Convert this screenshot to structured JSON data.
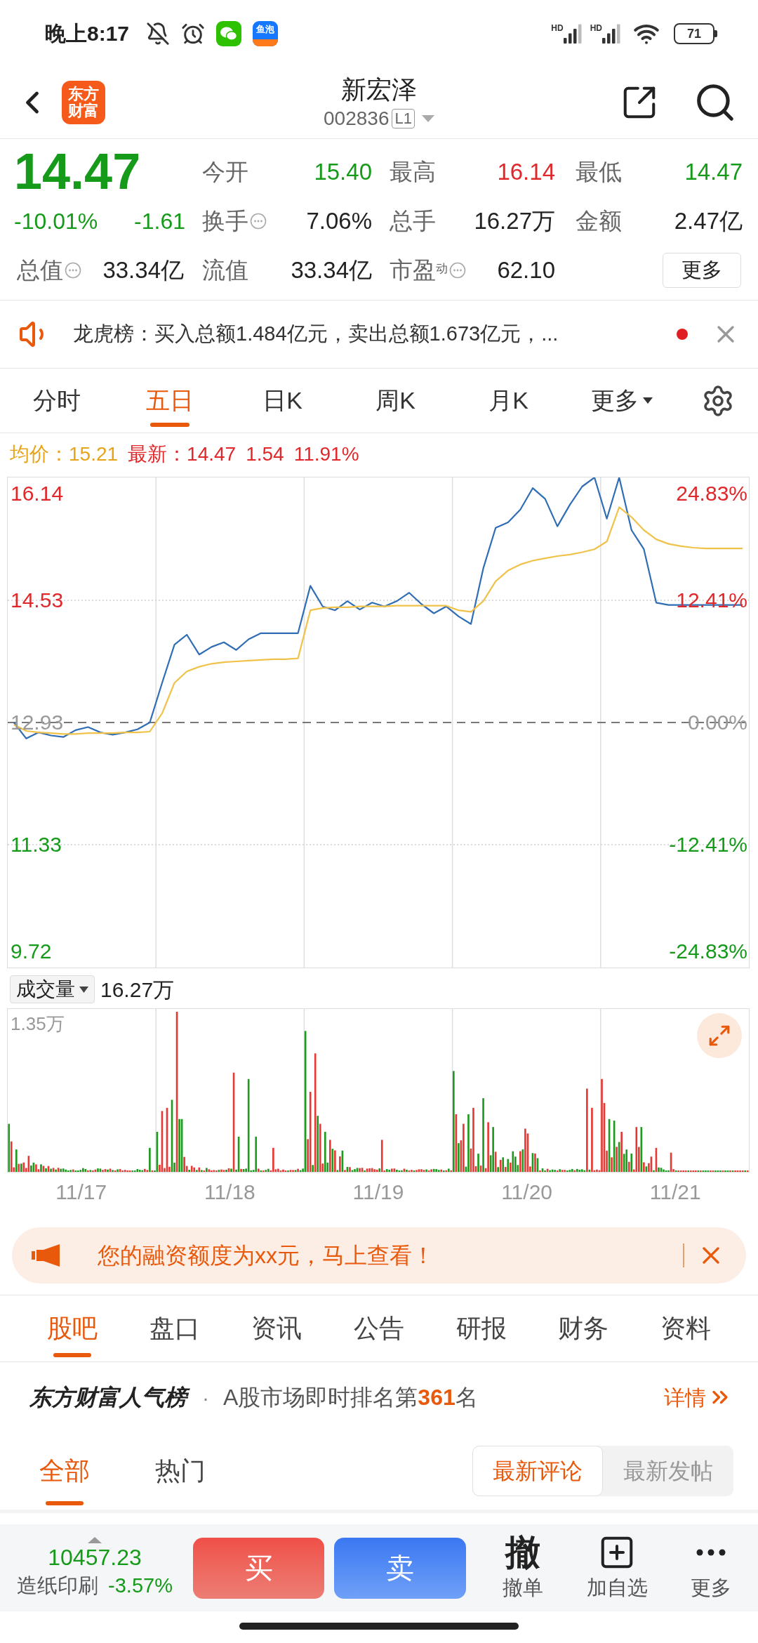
{
  "status_bar": {
    "time": "晚上8:17",
    "notification_icons": [
      {
        "kind": "mute"
      },
      {
        "kind": "alarm"
      },
      {
        "kind": "wechat"
      },
      {
        "kind": "app",
        "label": "鱼泡"
      }
    ],
    "signals": [
      {
        "label": "HD"
      },
      {
        "label": "HD"
      }
    ],
    "battery": "71"
  },
  "header": {
    "logo": "东方财富",
    "title": "新宏泽",
    "code": "002836",
    "level_badge": "L1"
  },
  "quote": {
    "price": "14.47",
    "change_pct": "-10.01%",
    "change": "-1.61",
    "color": "#169a1a",
    "stats": [
      {
        "label": "今开",
        "value": "15.40",
        "color": "#169a1a",
        "info": false
      },
      {
        "label": "最高",
        "value": "16.14",
        "color": "#e0282b",
        "info": false
      },
      {
        "label": "最低",
        "value": "14.47",
        "color": "#169a1a",
        "info": false
      },
      {
        "label": "换手",
        "value": "7.06%",
        "color": "#222222",
        "info": true
      },
      {
        "label": "总手",
        "value": "16.27万",
        "color": "#222222",
        "info": false
      },
      {
        "label": "金额",
        "value": "2.47亿",
        "color": "#222222",
        "info": false
      },
      {
        "label": "总值",
        "value": "33.34亿",
        "color": "#222222",
        "info": true
      },
      {
        "label": "流值",
        "value": "33.34亿",
        "color": "#222222",
        "info": false
      },
      {
        "label": "市盈$^{动}$",
        "value": "62.10",
        "color": "#222222",
        "info": true
      }
    ],
    "more_button": "更多"
  },
  "notice": {
    "text": "龙虎榜：买入总额1.484亿元，卖出总额1.673亿元，...",
    "unread": true
  },
  "chart_tabs": [
    {
      "label": "分时",
      "selected": false,
      "kind": "tab"
    },
    {
      "label": "五日",
      "selected": true,
      "kind": "tab"
    },
    {
      "label": "日K",
      "selected": false,
      "kind": "tab"
    },
    {
      "label": "周K",
      "selected": false,
      "kind": "tab"
    },
    {
      "label": "月K",
      "selected": false,
      "kind": "tab"
    },
    {
      "label": "更多",
      "selected": false,
      "kind": "menu"
    }
  ],
  "legend": [
    {
      "text": "均价：15.21",
      "kind": "avg"
    },
    {
      "text": "最新：14.47",
      "kind": "latest"
    },
    {
      "text": "1.54",
      "kind": "latest"
    },
    {
      "text": "11.91%",
      "kind": "latest"
    }
  ],
  "price_chart": {
    "axis_labels": [
      {
        "price": "16.14",
        "percent": "24.83%",
        "color": "#e0282b"
      },
      {
        "price": "14.53",
        "percent": "12.41%",
        "color": "#e0282b"
      },
      {
        "price": "12.93",
        "percent": "0.00%",
        "color": "#999999"
      },
      {
        "price": "11.33",
        "percent": "-12.41%",
        "color": "#169a1a"
      },
      {
        "price": "9.72",
        "percent": "-24.83%",
        "color": "#169a1a"
      }
    ],
    "chart_data": {
      "type": "line",
      "ylim": [
        9.72,
        16.14
      ],
      "yticks": [
        16.14,
        14.53,
        12.93,
        11.33,
        9.72
      ],
      "grid": true,
      "ref_lines": [
        {
          "axis": "y",
          "value": 12.93
        }
      ],
      "series": [
        {
          "color": "#2f6db5",
          "values": [
            12.93,
            12.72,
            12.8,
            12.76,
            12.74,
            12.83,
            12.87,
            12.8,
            12.77,
            12.8,
            12.84,
            12.93,
            13.45,
            13.95,
            14.08,
            13.82,
            13.92,
            13.98,
            13.88,
            14.02,
            14.1,
            14.1,
            14.1,
            14.1,
            14.72,
            14.45,
            14.4,
            14.52,
            14.41,
            14.5,
            14.45,
            14.52,
            14.63,
            14.48,
            14.36,
            14.45,
            14.32,
            14.22,
            14.95,
            15.48,
            15.55,
            15.72,
            16.0,
            15.86,
            15.5,
            15.78,
            16.02,
            16.14,
            15.6,
            16.14,
            15.45,
            15.2,
            14.5,
            14.47,
            14.47,
            14.47,
            14.47,
            14.47,
            14.47,
            14.47
          ]
        },
        {
          "color": "#f0c24a",
          "values": [
            12.9,
            12.82,
            12.8,
            12.79,
            12.78,
            12.78,
            12.79,
            12.79,
            12.79,
            12.8,
            12.8,
            12.81,
            13.05,
            13.45,
            13.6,
            13.66,
            13.7,
            13.72,
            13.73,
            13.74,
            13.75,
            13.76,
            13.76,
            13.77,
            14.4,
            14.43,
            14.44,
            14.44,
            14.45,
            14.45,
            14.45,
            14.46,
            14.46,
            14.46,
            14.46,
            14.46,
            14.4,
            14.38,
            14.52,
            14.78,
            14.92,
            15.0,
            15.05,
            15.08,
            15.11,
            15.13,
            15.16,
            15.2,
            15.3,
            15.75,
            15.62,
            15.45,
            15.33,
            15.27,
            15.24,
            15.22,
            15.21,
            15.21,
            15.21,
            15.21
          ]
        }
      ]
    }
  },
  "volume": {
    "selector": "成交量",
    "total": "16.27万",
    "max_label": "1.35万",
    "dates": [
      "11/17",
      "11/18",
      "11/19",
      "11/20",
      "11/21"
    ]
  },
  "promo": {
    "text": "您的融资额度为xx元，马上查看！"
  },
  "f10_tabs": [
    {
      "label": "股吧",
      "selected": true
    },
    {
      "label": "盘口",
      "selected": false
    },
    {
      "label": "资讯",
      "selected": false
    },
    {
      "label": "公告",
      "selected": false
    },
    {
      "label": "研报",
      "selected": false
    },
    {
      "label": "财务",
      "selected": false
    },
    {
      "label": "资料",
      "selected": false
    }
  ],
  "popularity": {
    "brand": "东方财富人气榜",
    "separator": "·",
    "text": "A股市场即时排名第**361**名",
    "link": "详情"
  },
  "feed_tabs": [
    {
      "label": "全部",
      "selected": true
    },
    {
      "label": "热门",
      "selected": false
    }
  ],
  "sort_options": [
    {
      "label": "最新评论",
      "selected": true
    },
    {
      "label": "最新发帖",
      "selected": false
    }
  ],
  "bottom_bar": {
    "index_value": "10457.23",
    "sector": "造纸印刷",
    "sector_change": "-3.57%",
    "color": "#169a1a",
    "buy": "买",
    "sell": "卖",
    "actions": [
      {
        "kind": "cancel",
        "glyph": "撤",
        "label": "撤单"
      },
      {
        "kind": "watchlist",
        "label": "加自选"
      },
      {
        "kind": "more",
        "label": "更多"
      }
    ]
  }
}
